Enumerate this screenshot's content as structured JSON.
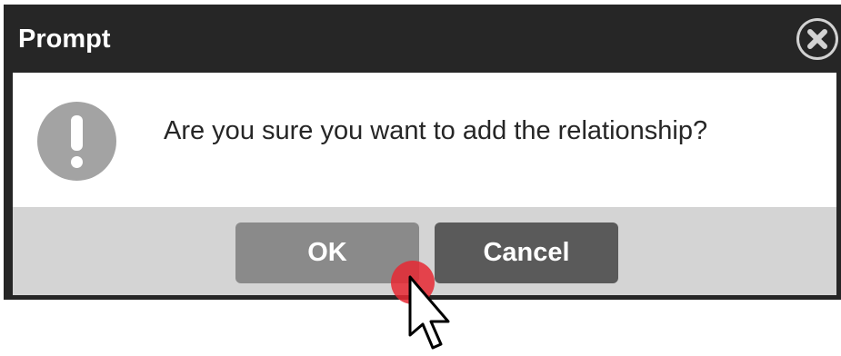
{
  "dialog": {
    "title": "Prompt",
    "message": "Are you sure you want to add the relationship?",
    "close_icon": "close-icon",
    "alert_icon": "exclamation-circle-icon"
  },
  "buttons": {
    "ok_label": "OK",
    "cancel_label": "Cancel"
  },
  "colors": {
    "titlebar": "#262626",
    "body": "#ffffff",
    "button_bar": "#d4d4d4",
    "ok_button": "#8a8a8a",
    "cancel_button": "#5a5a5a",
    "click_marker": "#e62832"
  }
}
